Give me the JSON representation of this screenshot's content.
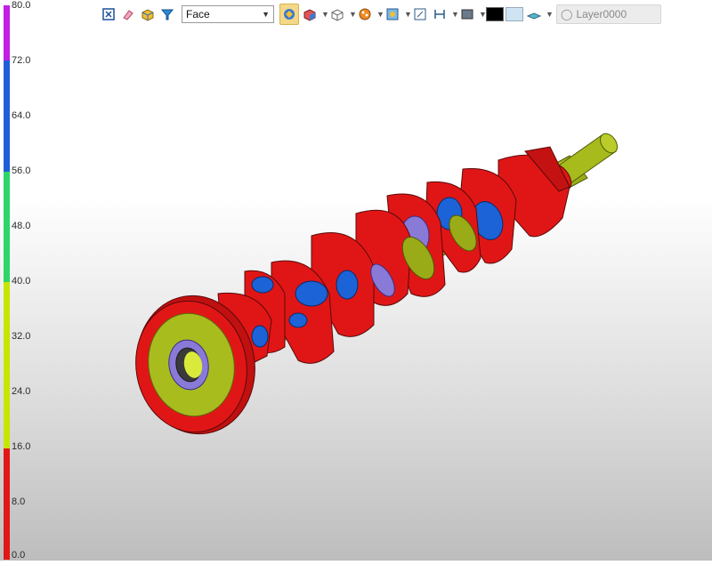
{
  "toolbar": {
    "face_select_value": "Face",
    "layer_name": "Layer0000",
    "buttons": [
      {
        "name": "pick-tool-icon"
      },
      {
        "name": "eraser-icon"
      },
      {
        "name": "solid-box-icon"
      },
      {
        "name": "filter-icon"
      }
    ],
    "colors": {
      "black_swatch": "#000000",
      "light_swatch": "#cfe4f3"
    }
  },
  "legend": {
    "ticks": [
      "80.0",
      "72.0",
      "64.0",
      "56.0",
      "48.0",
      "40.0",
      "32.0",
      "24.0",
      "16.0",
      "8.0",
      "0.0"
    ],
    "bands": [
      {
        "color": "#c21ee6",
        "from": 72,
        "to": 80
      },
      {
        "color": "#1f5ed8",
        "from": 56,
        "to": 72
      },
      {
        "color": "#2ed66a",
        "from": 40,
        "to": 56
      },
      {
        "color": "#c6e600",
        "from": 16,
        "to": 40
      },
      {
        "color": "#e01818",
        "from": 0,
        "to": 16
      }
    ]
  },
  "model": {
    "colors": {
      "red": "#e01616",
      "yellow": "#a9bc1e",
      "blue": "#1b63d6",
      "purple": "#8a7ad8",
      "dark": "#5a0a0a"
    }
  }
}
